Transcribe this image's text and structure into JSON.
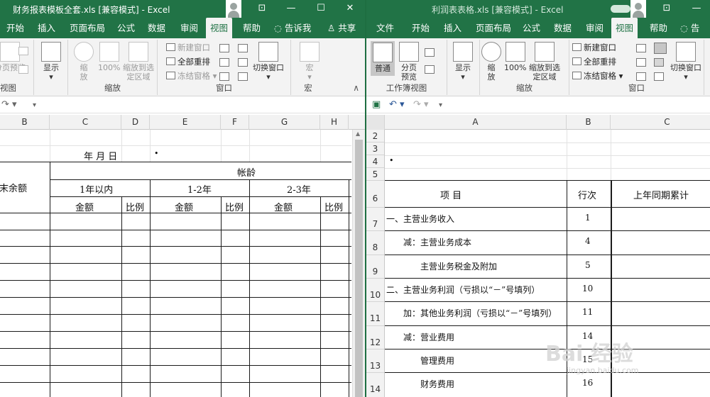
{
  "left": {
    "title": "财务报表模板全套.xls  [兼容模式]  -  Excel",
    "tabs": [
      "开始",
      "插入",
      "页面布局",
      "公式",
      "数据",
      "审阅",
      "视图",
      "帮助",
      "告诉我",
      "共享"
    ],
    "ribbon": {
      "page_preview": "分页预览",
      "display": "显示",
      "zoom": "缩放",
      "zoom100": "100%",
      "zoom_to_sel": "缩放到选定区域",
      "new_window": "新建窗口",
      "arrange_all": "全部重排",
      "freeze": "冻结窗格",
      "switch_window": "切换窗口",
      "macro": "宏",
      "group_view": "视图",
      "group_zoom": "缩放",
      "group_window": "窗口",
      "group_macro": "宏"
    },
    "col_headers": [
      "B",
      "C",
      "D",
      "E",
      "F",
      "G",
      "H"
    ],
    "cells": {
      "date_line": "年    月    日",
      "dot": "•",
      "period_end_balance": "期末余额",
      "aging": "帐龄",
      "within_1y": "1年以内",
      "y1_2": "1-2年",
      "y2_3": "2-3年",
      "amount": "金额",
      "ratio": "比例"
    }
  },
  "right": {
    "title": "利润表表格.xls  [兼容模式]  -  Excel",
    "tabs": [
      "文件",
      "开始",
      "插入",
      "页面布局",
      "公式",
      "数据",
      "审阅",
      "视图",
      "帮助",
      "告"
    ],
    "ribbon": {
      "normal": "普通",
      "page_preview": "分页预览",
      "display": "显示",
      "zoom": "缩放",
      "zoom100": "100%",
      "zoom_to_sel": "缩放到选定区域",
      "new_window": "新建窗口",
      "arrange_all": "全部重排",
      "freeze": "冻结窗格",
      "switch_window": "切换窗口",
      "group_view": "工作簿视图",
      "group_zoom": "缩放",
      "group_window": "窗口"
    },
    "col_headers": [
      "A",
      "B",
      "C"
    ],
    "row_headers": [
      "2",
      "3",
      "4",
      "5",
      "6",
      "7",
      "8",
      "9",
      "10",
      "11",
      "12",
      "13",
      "14"
    ],
    "cells": {
      "dot": "•",
      "hdr_item": "项                目",
      "hdr_line": "行次",
      "hdr_prev": "上年同期累计"
    },
    "rows": [
      {
        "item": "一、主营业务收入",
        "line": "1"
      },
      {
        "item": "减：主营业务成本",
        "line": "4"
      },
      {
        "item": "主营业务税金及附加",
        "line": "5"
      },
      {
        "item": "二、主营业务利润（亏损以“－”号填列）",
        "line": "10"
      },
      {
        "item": "加：其他业务利润（亏损以“－”号填列）",
        "line": "11"
      },
      {
        "item": "减：营业费用",
        "line": "14"
      },
      {
        "item": "管理费用",
        "line": "15"
      },
      {
        "item": "财务费用",
        "line": "16"
      }
    ]
  },
  "watermark": {
    "brand": "Bai 经验",
    "url": "jingyan.baidu.com"
  }
}
